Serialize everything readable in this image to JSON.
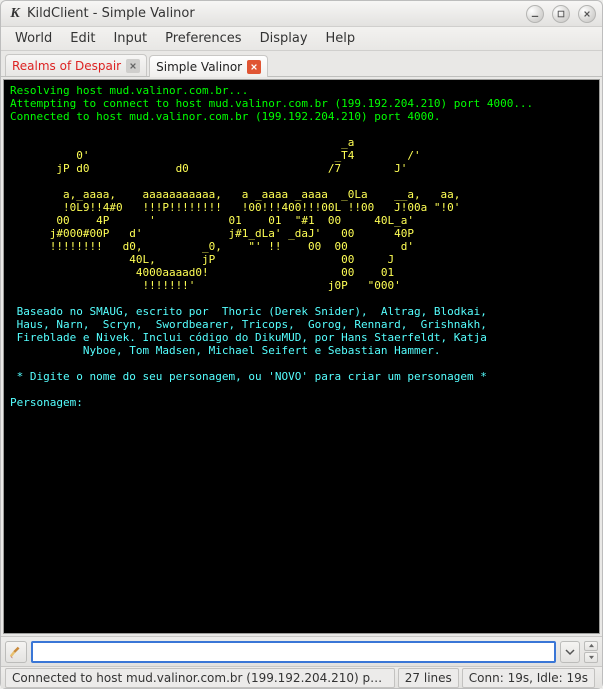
{
  "window": {
    "title": "KildClient - Simple Valinor"
  },
  "menu": {
    "items": [
      "World",
      "Edit",
      "Input",
      "Preferences",
      "Display",
      "Help"
    ]
  },
  "tabs": [
    {
      "label": "Realms of Despair",
      "active": false,
      "close_style": "grey"
    },
    {
      "label": "Simple Valinor",
      "active": true,
      "close_style": "red"
    }
  ],
  "terminal": {
    "green_lines": [
      "Resolving host mud.valinor.com.br...",
      "Attempting to connect to host mud.valinor.com.br (199.192.204.210) port 4000...",
      "Connected to host mud.valinor.com.br (199.192.204.210) port 4000."
    ],
    "ascii_art": "\n                                                  _a\n          0'                                     _T4        /'\n       jP d0             d0                     /7        J'\n\n        a,_aaaa,    aaaaaaaaaaa,   a _aaaa _aaaa  _0La    __a,   aa,\n        !0L9!!4#0   !!!P!!!!!!!!   !00!!!400!!!00L !!00   J!00a \"!0'\n       00    4P      '           01    01  \"#1  00     40L_a'\n      j#000#00P   d'             j#1_dLa' _daJ'   00      40P\n      !!!!!!!!   d0,         _0,    \"' !!    00  00        d'\n                  40L,       jP                   00     J\n                   4000aaaad0!                    00    01\n                    !!!!!!!'                    j0P   \"000'\n",
    "credits": "\n Baseado no SMAUG, escrito por  Thoric (Derek Snider),  Altrag, Blodkai,\n Haus, Narn,  Scryn,  Swordbearer, Tricops,  Gorog, Rennard,  Grishnakh,\n Fireblade e Nivek. Inclui código do DikuMUD, por Hans Staerfeldt, Katja\n           Nyboe, Tom Madsen, Michael Seifert e Sebastian Hammer.\n\n * Digite o nome do seu personagem, ou 'NOVO' para criar um personagem *\n\nPersonagem:"
  },
  "input": {
    "value": "",
    "placeholder": ""
  },
  "status": {
    "connection": "Connected to host mud.valinor.com.br (199.192.204.210) p…",
    "lines": "27 lines",
    "timing": "Conn: 19s, Idle: 19s"
  }
}
